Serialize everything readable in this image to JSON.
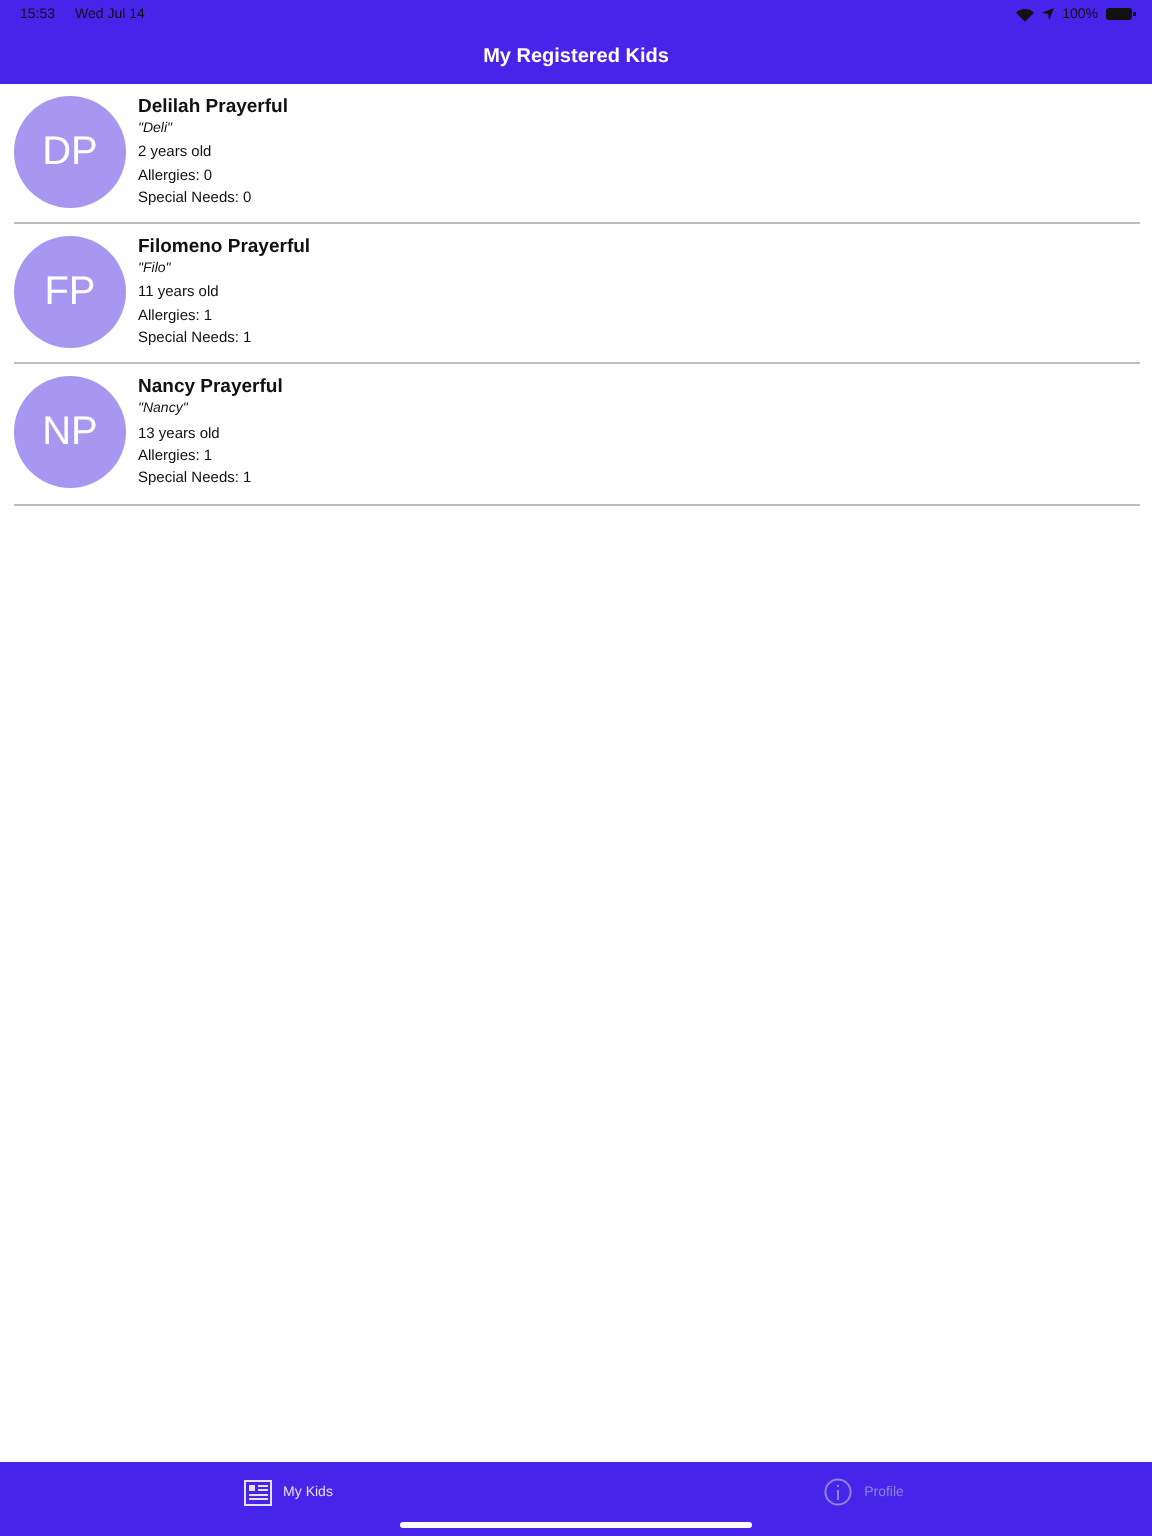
{
  "status_bar": {
    "time": "15:53",
    "date": "Wed Jul 14",
    "battery": "100%"
  },
  "nav": {
    "title": "My Registered Kids"
  },
  "kids": [
    {
      "initials": "DP",
      "name": "Delilah Prayerful",
      "nickname": "\"Deli\"",
      "age": "2 years old",
      "allergies": "Allergies: 0",
      "special_needs": "Special Needs: 0"
    },
    {
      "initials": "FP",
      "name": "Filomeno Prayerful",
      "nickname": "\"Filo\"",
      "age": "11 years old",
      "allergies": "Allergies: 1",
      "special_needs": "Special Needs: 1"
    },
    {
      "initials": "NP",
      "name": "Nancy Prayerful",
      "nickname": "\"Nancy\"",
      "age": "13 years old",
      "allergies": "Allergies: 1",
      "special_needs": "Special Needs: 1"
    }
  ],
  "tabs": [
    {
      "label": "My Kids",
      "kind": "list",
      "selected": true
    },
    {
      "label": "Profile",
      "kind": "info",
      "selected": false
    }
  ]
}
